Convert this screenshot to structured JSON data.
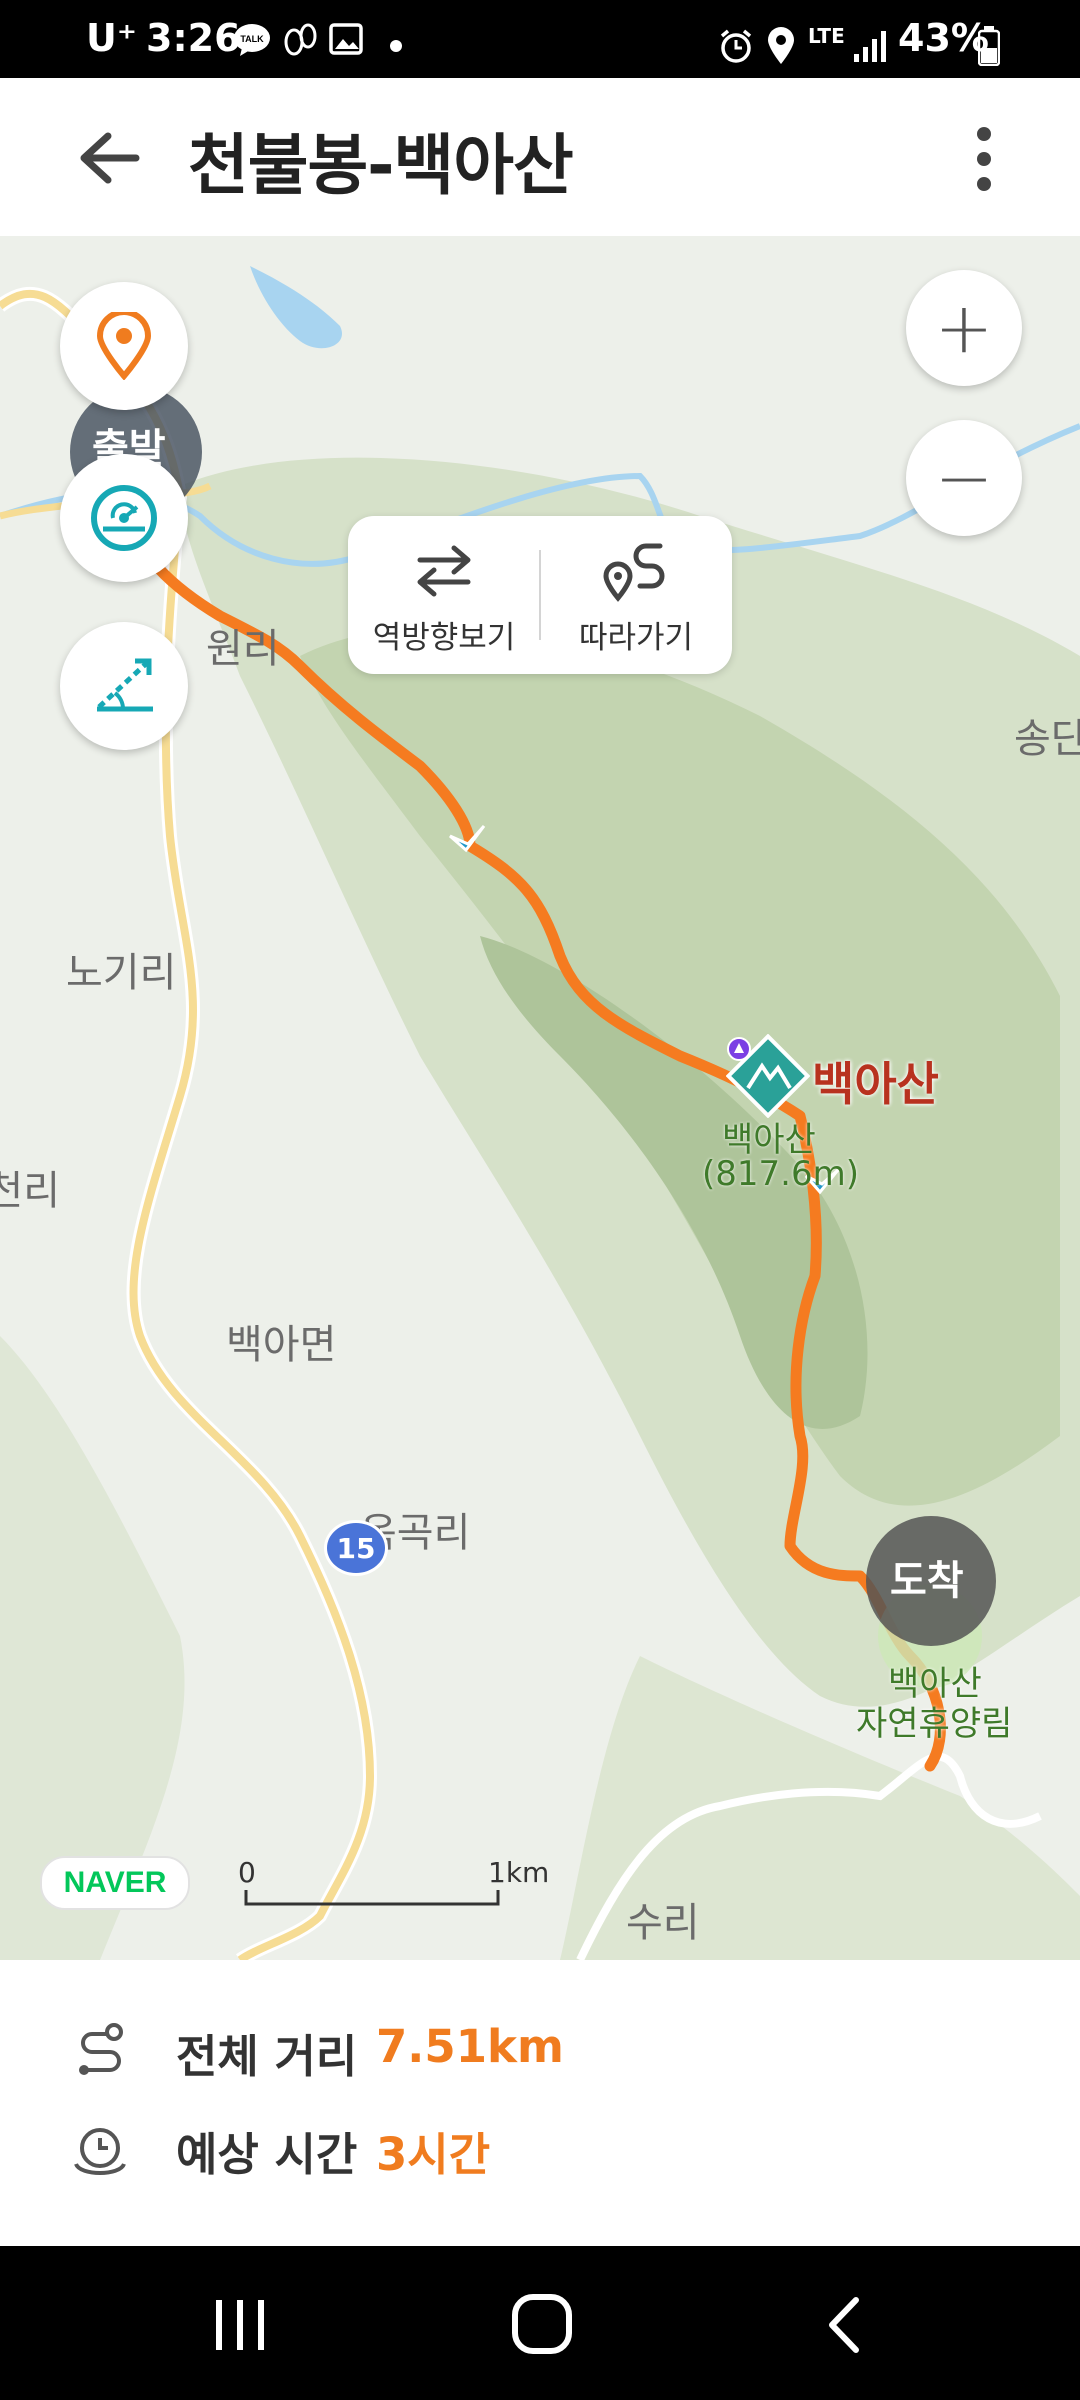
{
  "status_bar": {
    "carrier": "U⁺",
    "time": "3:26",
    "network": "LTE",
    "battery": "43%",
    "icons": [
      "kakaotalk-icon",
      "talk-icon",
      "footprint-icon",
      "image-icon",
      "dot-icon",
      "alarm-icon",
      "location-icon",
      "signal-icon",
      "battery-icon"
    ]
  },
  "header": {
    "title": "천불봉-백아산",
    "back_icon": "back-arrow-icon",
    "menu_icon": "more-vertical-icon"
  },
  "map_controls": {
    "reverse_label": "역방향보기",
    "follow_label": "따라가기",
    "zoom_in": "+",
    "zoom_out": "−",
    "left_buttons": [
      "location-pin-icon",
      "speedometer-icon",
      "slope-icon"
    ]
  },
  "map": {
    "start_label": "출발",
    "end_label": "도착",
    "peak_name": "백아산",
    "peak_sub_name": "백아산",
    "peak_elevation": "(817.6m)",
    "forest_name": "백아산",
    "forest_name_2": "자연휴양림",
    "places": {
      "wonri": "원리",
      "nogiri": "노기리",
      "cheonri": "천리",
      "baekamyeon": "백아면",
      "okgokri": "옥곡리",
      "suri": "수리",
      "songdan": "송단"
    },
    "road_number": "15",
    "brand": "NAVER",
    "scale_start": "0",
    "scale_end": "1km",
    "colors": {
      "route": "#f57b20",
      "brand": "#03c75a",
      "peak_marker": "#2aa198"
    }
  },
  "summary": {
    "distance_label": "전체 거리",
    "distance_value": "7.51km",
    "time_label": "예상 시간",
    "time_value": "3시간"
  },
  "nav_bar": {
    "recent_icon": "recent-apps-icon",
    "home_icon": "home-icon",
    "back_icon": "back-icon"
  }
}
